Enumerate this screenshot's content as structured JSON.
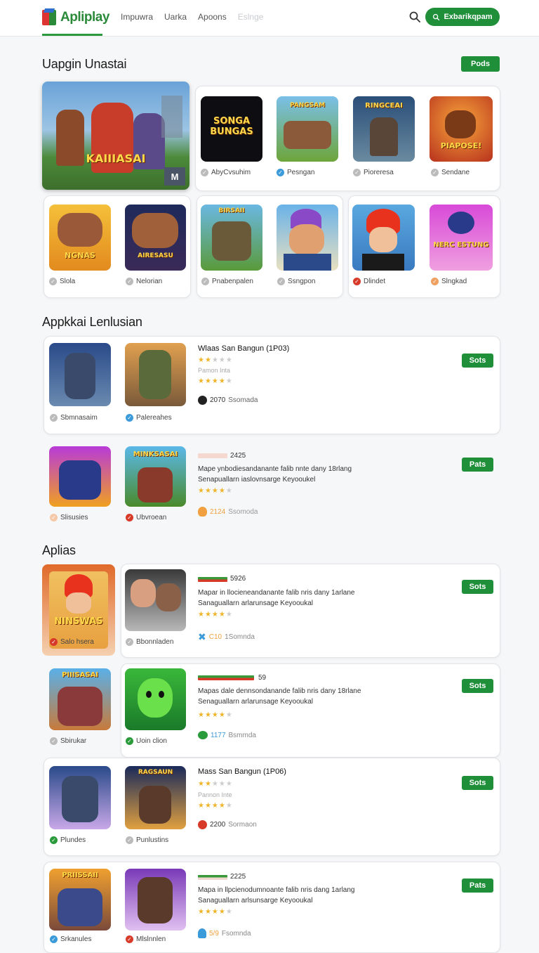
{
  "header": {
    "logo_text": "Apliplay",
    "nav": [
      "Impuwra",
      "Uarka",
      "Apoons",
      "Eslnge"
    ],
    "cta_label": "Exbarikqpam"
  },
  "section1": {
    "title": "Uapgin Unastai",
    "button": "Pods",
    "featured": {
      "title": "KAIIIASAI",
      "badge": "M"
    },
    "row1": [
      {
        "name": "AbyCvsuhim",
        "icon_text": "SONGA BUNGAS",
        "check": "gray"
      },
      {
        "name": "Pesngan",
        "icon_text": "PANGSAM",
        "check": "blue"
      },
      {
        "name": "Pioreresa",
        "icon_text": "RINGCEAI",
        "check": "gray"
      },
      {
        "name": "Sendane",
        "icon_text": "PIAPOSE!",
        "check": "gray"
      }
    ],
    "row2": [
      {
        "name": "Slola",
        "icon_text": "NGNAS",
        "check": "gray"
      },
      {
        "name": "Nelorian",
        "icon_text": "AIRESASU",
        "check": "gray"
      },
      {
        "name": "Pnabenpalen",
        "icon_text": "BIRSAII",
        "check": "gray"
      },
      {
        "name": "Ssngpon",
        "icon_text": "",
        "check": "gray"
      },
      {
        "name": "Dlindet",
        "icon_text": "",
        "check": "red"
      },
      {
        "name": "Slngkad",
        "icon_text": "NERC ESTUNG",
        "check": "orange"
      }
    ]
  },
  "section2": {
    "title": "Appkkai Lenlusian",
    "items": [
      {
        "icons": [
          {
            "name": "Sbmnasaim",
            "check": "gray"
          },
          {
            "name": "Palereahes",
            "check": "blue"
          }
        ],
        "title": "Wlaas San Bangun (1P03)",
        "sub": "Pamon Inta",
        "count": "2070",
        "count_label": "Ssomada",
        "button": "Sots"
      },
      {
        "icons": [
          {
            "name": "Slisusies",
            "check": "peach"
          },
          {
            "name": "Ubvroean",
            "check": "red",
            "icon_text": "MINKSASAI"
          }
        ],
        "bar_num": "2425",
        "desc1": "Mape ynbodiesandanante falib nnte dany 18rlang",
        "desc2": "Senapuallarn iaslovnsarge Keyooukel",
        "count": "2124",
        "count_label": "Ssomoda",
        "button": "Pats"
      }
    ]
  },
  "section3": {
    "title": "Aplias",
    "items": [
      {
        "icons": [
          {
            "name": "Salo hsera",
            "check": "red",
            "icon_text": "NINSWAS"
          },
          {
            "name": "Bbonnladen",
            "check": "gray"
          }
        ],
        "bar_num": "5926",
        "desc1": "Mapar in llocieneandanante falib nris dany 1arlane",
        "desc2": "Sanaguallarn arlarunsage Keyooukal",
        "count": "C10",
        "count_label": "1Somnda",
        "button": "Sots"
      },
      {
        "icons": [
          {
            "name": "Sbirukar",
            "check": "gray",
            "icon_text": "PIIISASAI"
          },
          {
            "name": "Uoin clion",
            "check": "green"
          }
        ],
        "bar_num": "59",
        "desc1": "Mapas dale dennsondanande falib nris dany 18rlane",
        "desc2": "Senaguallarn arlarunsage Keyooukal",
        "count": "1177",
        "count_label": "Bsmmda",
        "button": "Sots"
      },
      {
        "icons": [
          {
            "name": "Plundes",
            "check": "green"
          },
          {
            "name": "Punlustins",
            "check": "gray",
            "icon_text": "RAGSAUN"
          }
        ],
        "title": "Mass San Bangun (1P06)",
        "sub": "Pannon Inte",
        "count": "2200",
        "count_label": "Sormaon",
        "button": "Sots"
      },
      {
        "icons": [
          {
            "name": "Srkanules",
            "check": "blue",
            "icon_text": "PRIISSAII"
          },
          {
            "name": "Mlslnnlen",
            "check": "red"
          }
        ],
        "bar_num": "2225",
        "desc1": "Mapa in llpcienodumnoante falib nris dang 1arlang",
        "desc2": "Sanaguallarn arlsunsarge Keyooukal",
        "count": "5/9",
        "count_label": "Fsomnda",
        "button": "Pats"
      }
    ]
  },
  "colors": {
    "accent": "#1f8f3a",
    "star": "#f0b429"
  }
}
